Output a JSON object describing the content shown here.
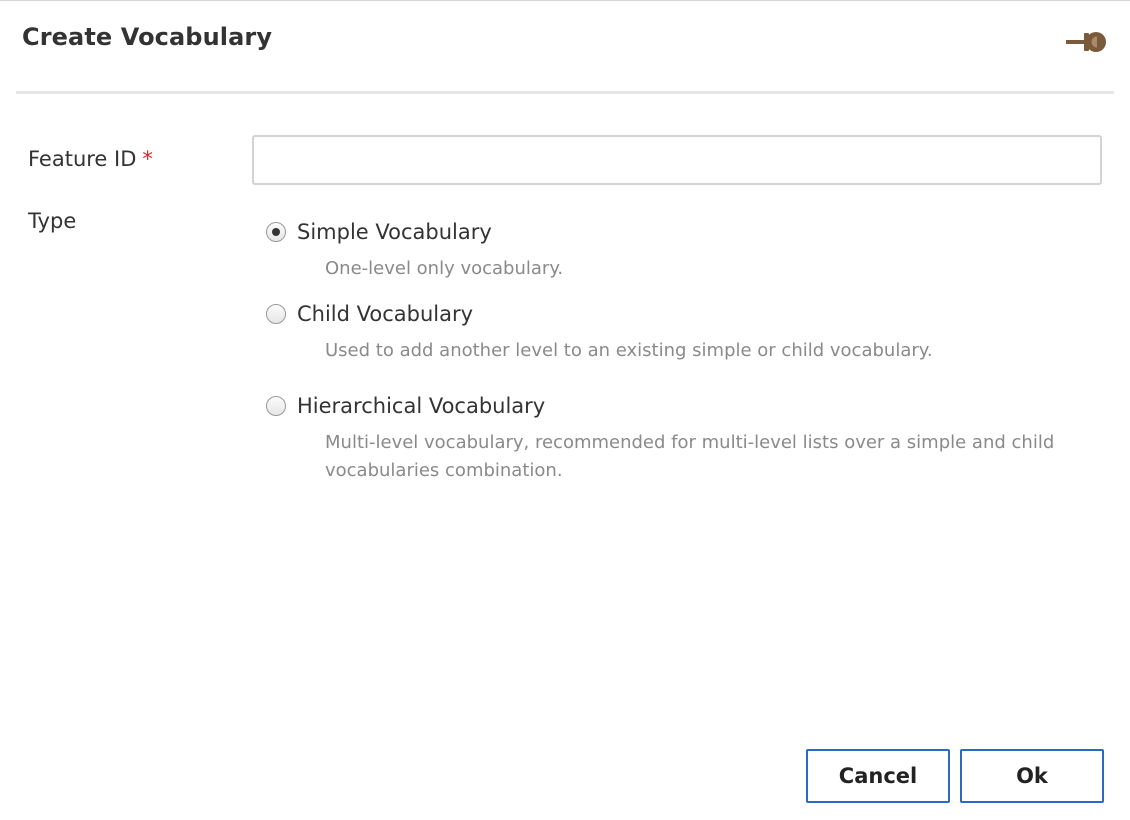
{
  "dialog": {
    "title": "Create Vocabulary",
    "pin_icon": "pin-icon"
  },
  "form": {
    "feature_id_label": "Feature ID",
    "required_marker": "*",
    "feature_id_value": "",
    "type_label": "Type",
    "type_options": [
      {
        "label": "Simple Vocabulary",
        "description": "One-level only vocabulary.",
        "selected": true
      },
      {
        "label": "Child Vocabulary",
        "description": "Used to add another level to an existing simple or child vocabulary.",
        "selected": false
      },
      {
        "label": "Hierarchical Vocabulary",
        "description": "Multi-level vocabulary, recommended for multi-level lists over a simple and child vocabularies combination.",
        "selected": false
      }
    ]
  },
  "buttons": {
    "cancel": "Cancel",
    "ok": "Ok"
  },
  "colors": {
    "accent_border": "#2a6ac4",
    "required": "#d9262b",
    "pin_icon": "#7a5a3a"
  }
}
